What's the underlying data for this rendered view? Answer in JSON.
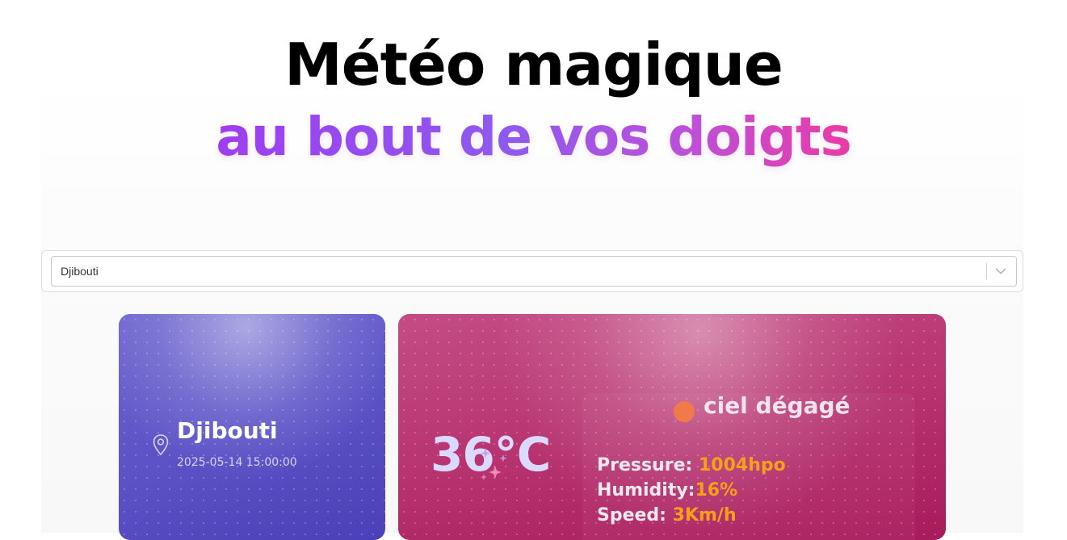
{
  "hero": {
    "title": "Météo magique",
    "subtitle": "au bout de vos doigts"
  },
  "city_select": {
    "value": "Djibouti",
    "icon": "chevron-down-icon"
  },
  "location_card": {
    "icon": "map-pin-icon",
    "city": "Djibouti",
    "datetime": "2025-05-14 15:00:00"
  },
  "weather_card": {
    "temperature": "36°C",
    "condition_icon": "sun-icon",
    "condition": "ciel dégagé",
    "stats": [
      {
        "label": "Pressure: ",
        "value": "1004hpo"
      },
      {
        "label": "Humidity:",
        "value": "16%"
      },
      {
        "label": "Speed: ",
        "value": "3Km/h"
      }
    ]
  },
  "colors": {
    "gradient_start": "#9f3cf2",
    "gradient_end": "#f23aa0",
    "left_card": "#5b53c6",
    "right_card": "#b73470",
    "stat_value": "#f6a01a"
  }
}
